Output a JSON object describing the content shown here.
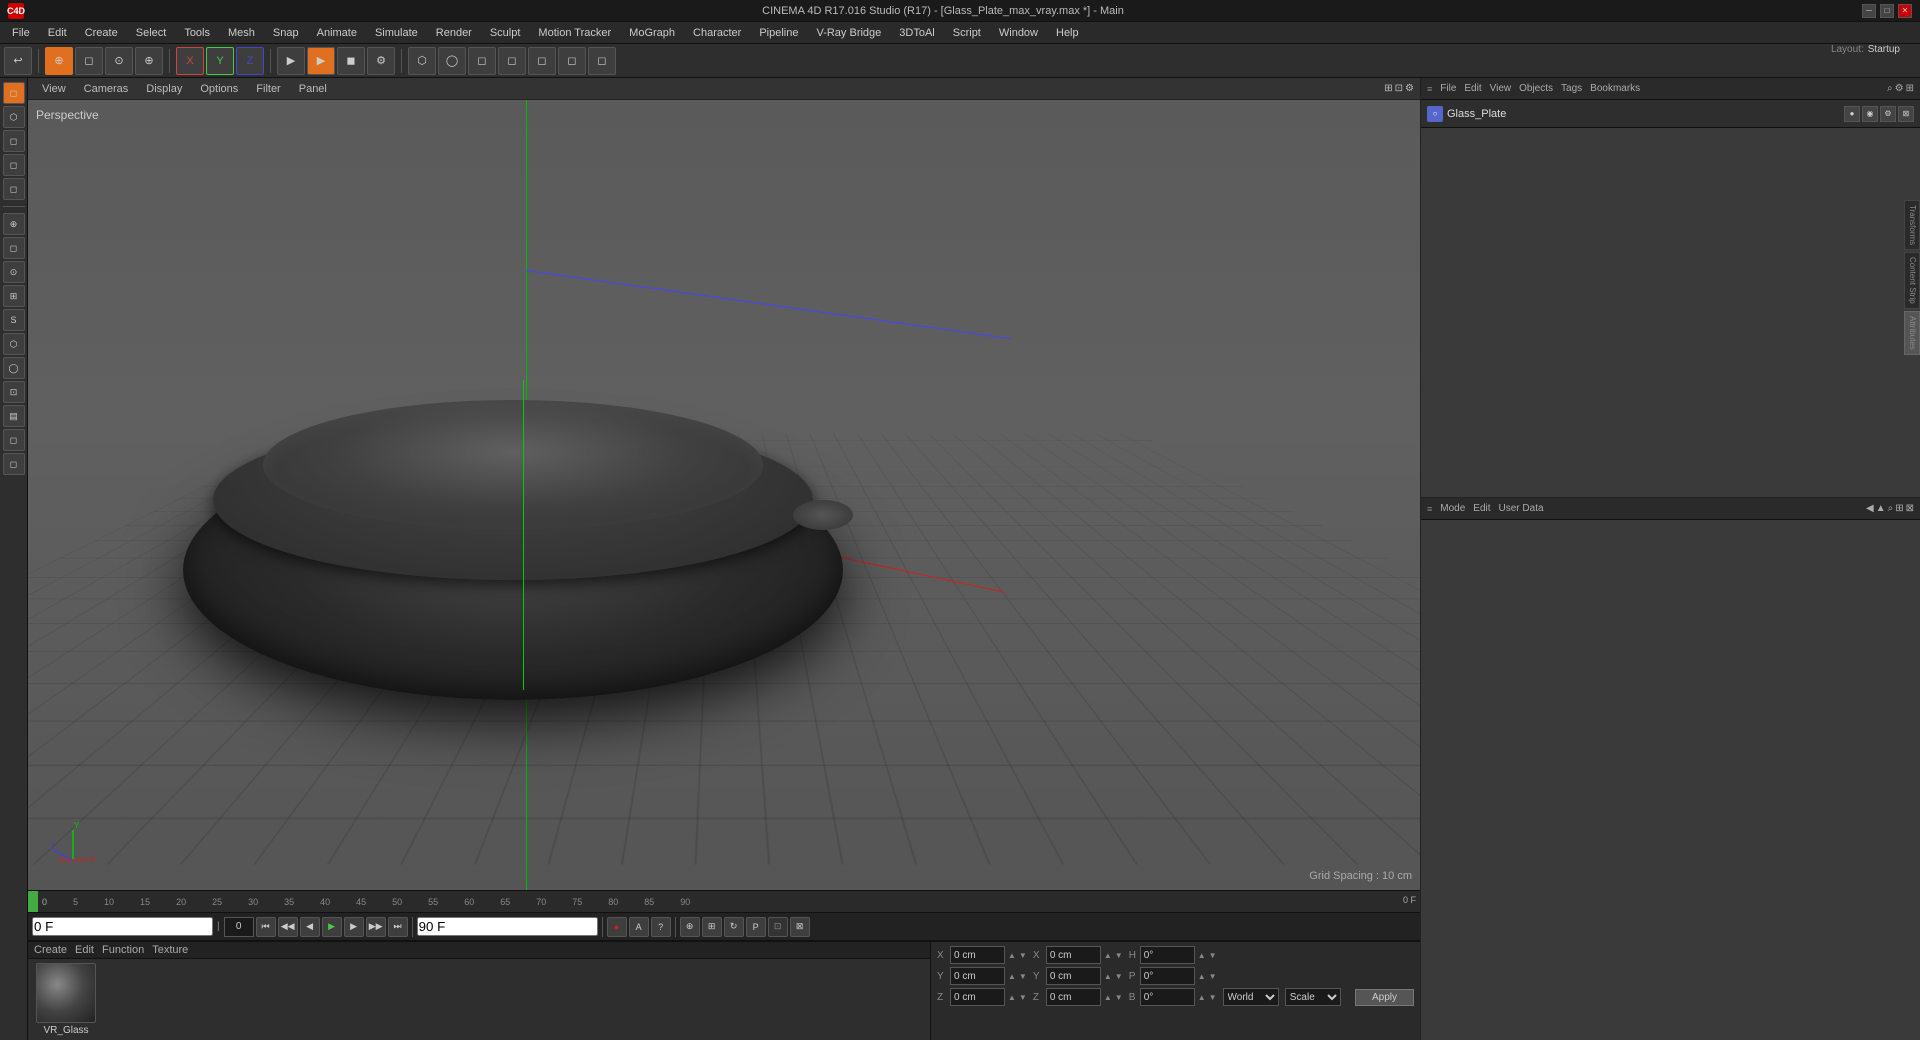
{
  "titlebar": {
    "app_icon": "C4D",
    "title": "CINEMA 4D R17.016 Studio (R17) - [Glass_Plate_max_vray.max *] - Main",
    "minimize": "─",
    "maximize": "□",
    "close": "✕"
  },
  "menubar": {
    "items": [
      "File",
      "Edit",
      "Create",
      "Select",
      "Tools",
      "Mesh",
      "Snap",
      "Animate",
      "Simulate",
      "Render",
      "Sculpt",
      "Motion Tracker",
      "MoGraph",
      "Character",
      "Pipeline",
      "V-Ray Bridge",
      "3DToAl",
      "Script",
      "Window",
      "Help"
    ]
  },
  "toolbar": {
    "undo_label": "↩",
    "mode_buttons": [
      "↺",
      "⊕",
      "◻",
      "⊙",
      "⊕"
    ],
    "axis_x": "X",
    "axis_y": "Y",
    "axis_z": "Z",
    "render_buttons": [
      "▶",
      "◼",
      "◻",
      "⬡",
      "◯",
      "⚙",
      "◻",
      "◻",
      "◻"
    ]
  },
  "viewport": {
    "label": "Perspective",
    "menus": [
      "View",
      "Cameras",
      "Display",
      "Options",
      "Filter",
      "Panel"
    ],
    "grid_spacing": "Grid Spacing : 10 cm"
  },
  "left_toolbar": {
    "tools": [
      "◻",
      "⬡",
      "◻",
      "⊙",
      "◻",
      "◻",
      "◻",
      "◻",
      "◻",
      "◻",
      "◻",
      "◻",
      "◻",
      "◻",
      "◻",
      "◻"
    ]
  },
  "right_panel": {
    "header_menu_items": [
      "File",
      "Edit",
      "View",
      "Objects",
      "Tags",
      "Bookmarks"
    ],
    "object_name": "Glass_Plate",
    "tabs": [
      "Objects",
      "Tags",
      "Bookmarks"
    ],
    "attributes": {
      "header_items": [
        "Mode",
        "Edit",
        "User Data"
      ],
      "nav_items": [
        "◀",
        "▲",
        "⌕",
        "⊞",
        "⊠"
      ]
    }
  },
  "timeline": {
    "frame_markers": [
      "0",
      "5",
      "10",
      "15",
      "20",
      "25",
      "30",
      "35",
      "40",
      "45",
      "50",
      "55",
      "60",
      "65",
      "70",
      "75",
      "80",
      "85",
      "90"
    ],
    "current_frame": "0 F",
    "end_frame_label": "90 F",
    "green_marker_pos": "0"
  },
  "transport": {
    "frame_input": "0 F",
    "frame_start_input": "0",
    "frame_end": "90 F",
    "buttons": [
      "⏮",
      "◀",
      "▶",
      "▶▶",
      "⏭",
      "↺",
      "⏹"
    ],
    "record_btn": "●",
    "autokey_btn": "A",
    "help_btn": "?"
  },
  "bottom_panel": {
    "menus": [
      "Create",
      "Edit",
      "Function",
      "Texture"
    ],
    "material_name": "VR_Glass"
  },
  "coord_panel": {
    "x_label": "X",
    "y_label": "Y",
    "z_label": "Z",
    "x_value": "0 cm",
    "y_value": "0 cm",
    "z_value": "0 cm",
    "x2_label": "X",
    "y2_label": "Y",
    "z2_label": "Z",
    "x2_value": "0 cm",
    "y2_value": "0 cm",
    "z2_value": "0 cm",
    "h_label": "H",
    "p_label": "P",
    "b_label": "B",
    "h_value": "0°",
    "p_value": "0°",
    "b_value": "0°",
    "world_label": "World",
    "scale_label": "Scale",
    "apply_label": "Apply"
  },
  "layout": {
    "label": "Layout:",
    "name": "Startup"
  }
}
